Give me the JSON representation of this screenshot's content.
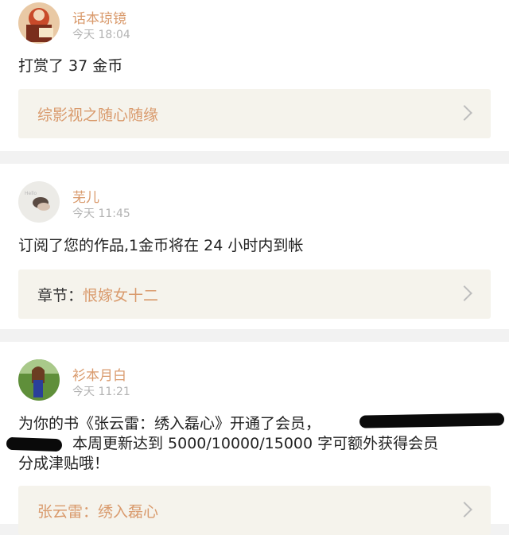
{
  "feed": [
    {
      "user": "话本琼镜",
      "time": "今天 18:04",
      "message": "打赏了 37 金币",
      "link_prefix": "",
      "link_value": "综影视之随心随缘"
    },
    {
      "user": "芜儿",
      "time": "今天 11:45",
      "message": "订阅了您的作品,1金币将在 24 小时内到帐",
      "link_prefix": "章节：",
      "link_value": "恨嫁女十二"
    },
    {
      "user": "衫本月白",
      "time": "今天 11:21",
      "message_line1": "为你的书《张云雷：绣入磊心》开通了会员，",
      "message_line2": "本周更新达到 5000/10000/15000 字可额外获得会员",
      "message_line3": "分成津贴哦！",
      "link_prefix": "",
      "link_value": "张云雷：绣入磊心"
    }
  ],
  "colors": {
    "accent": "#d99a6c",
    "time": "#b3b3b3",
    "link_bg": "#f5f3ec",
    "separator": "#f2f2f2"
  },
  "icons": {
    "chevron": "chevron-right-icon",
    "avatar": "user-avatar"
  }
}
